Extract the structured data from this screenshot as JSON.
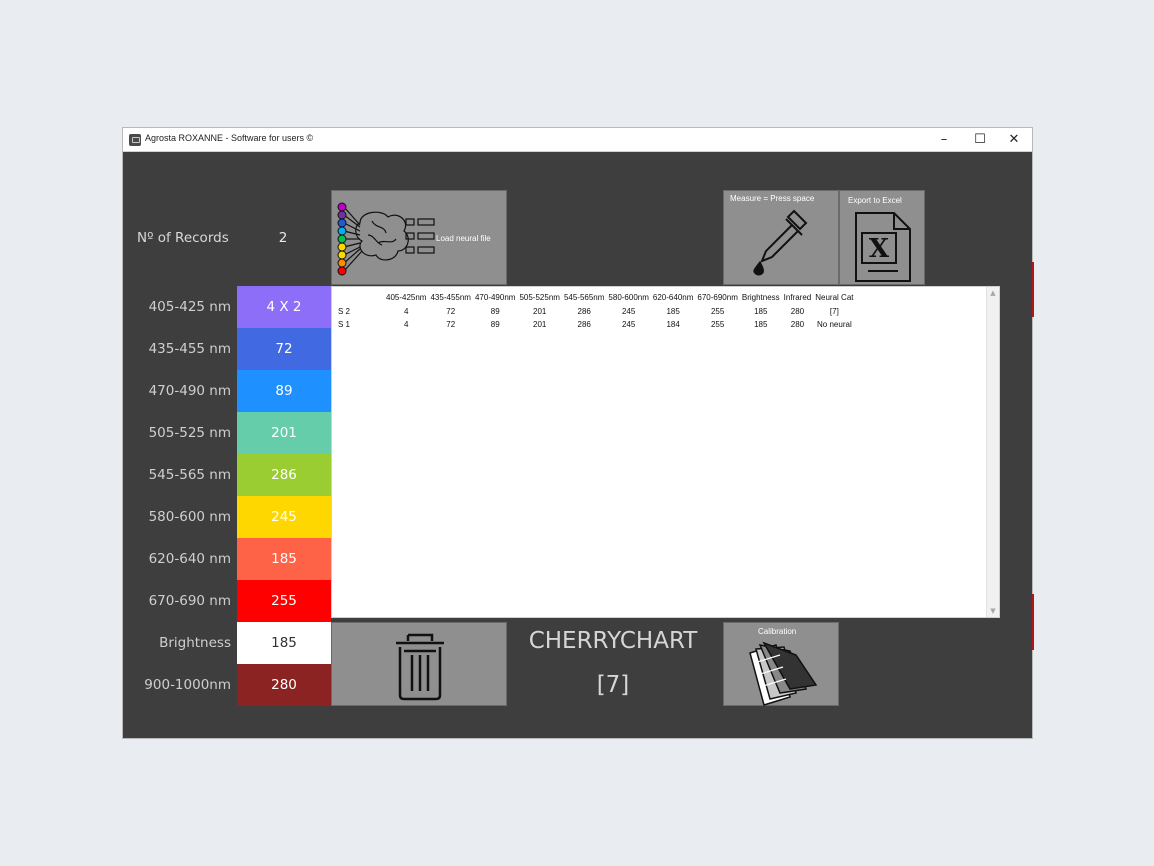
{
  "window": {
    "title": "Agrosta ROXANNE - Software for users ©",
    "controls": {
      "minimize": "–",
      "maximize": "☐",
      "close": "✕"
    }
  },
  "records": {
    "label": "Nº of Records",
    "value": "2"
  },
  "bands": [
    {
      "label": "405-425 nm",
      "value": "4 X 2",
      "color": "#8d6ef8"
    },
    {
      "label": "435-455 nm",
      "value": "72",
      "color": "#4169e1"
    },
    {
      "label": "470-490 nm",
      "value": "89",
      "color": "#1e90ff"
    },
    {
      "label": "505-525 nm",
      "value": "201",
      "color": "#66cdaa"
    },
    {
      "label": "545-565 nm",
      "value": "286",
      "color": "#9acd32"
    },
    {
      "label": "580-600 nm",
      "value": "245",
      "color": "#ffd700"
    },
    {
      "label": "620-640 nm",
      "value": "185",
      "color": "#ff6347"
    },
    {
      "label": "670-690 nm",
      "value": "255",
      "color": "#ff0000"
    },
    {
      "label": "Brightness",
      "value": "185",
      "color": "#ffffff"
    },
    {
      "label": "900-1000nm",
      "value": "280",
      "color": "#8b2323"
    }
  ],
  "buttons": {
    "load_neural": "Load neural file",
    "measure": "Measure = Press space",
    "export": "Export to Excel",
    "calibration": "Calibration",
    "delete_icon": "trash-icon"
  },
  "table": {
    "headers": [
      "",
      "405-425nm",
      "435-455nm",
      "470-490nm",
      "505-525nm",
      "545-565nm",
      "580-600nm",
      "620-640nm",
      "670-690nm",
      "Brightness",
      "Infrared",
      "Neural Cat"
    ],
    "rows": [
      [
        "S 2",
        "4",
        "72",
        "89",
        "201",
        "286",
        "245",
        "185",
        "255",
        "185",
        "280",
        "[7]"
      ],
      [
        "S 1",
        "4",
        "72",
        "89",
        "201",
        "286",
        "245",
        "184",
        "255",
        "185",
        "280",
        "No neural"
      ]
    ]
  },
  "chart": {
    "title": "CHERRYCHART",
    "category": "[7]"
  },
  "colors": {
    "window_bg": "#3e3e3e",
    "button_bg": "#8f8f8f",
    "text_light": "#cfcfcf"
  }
}
